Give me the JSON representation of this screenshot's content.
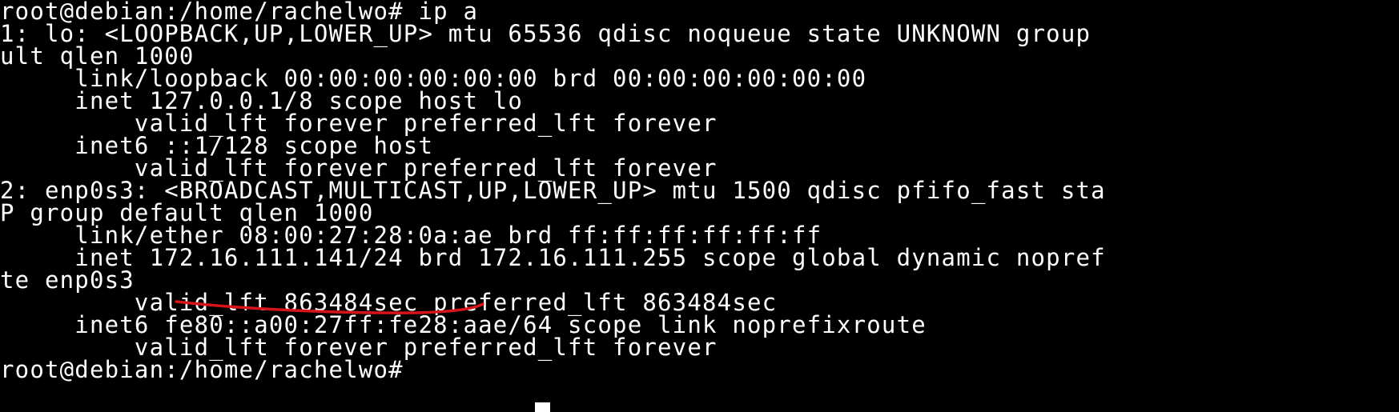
{
  "terminal": {
    "lines": [
      "root@debian:/home/rachelwo# ip a",
      "1: lo: <LOOPBACK,UP,LOWER_UP> mtu 65536 qdisc noqueue state UNKNOWN group",
      "ult qlen 1000",
      "     link/loopback 00:00:00:00:00:00 brd 00:00:00:00:00:00",
      "     inet 127.0.0.1/8 scope host lo",
      "         valid_lft forever preferred_lft forever",
      "     inet6 ::1/128 scope host",
      "         valid_lft forever preferred_lft forever",
      "2: enp0s3: <BROADCAST,MULTICAST,UP,LOWER_UP> mtu 1500 qdisc pfifo_fast sta",
      "P group default qlen 1000",
      "     link/ether 08:00:27:28:0a:ae brd ff:ff:ff:ff:ff:ff",
      "     inet 172.16.111.141/24 brd 172.16.111.255 scope global dynamic nopref",
      "te enp0s3",
      "         valid_lft 863484sec preferred_lft 863484sec",
      "     inet6 fe80::a00:27ff:fe28:aae/64 scope link noprefixroute",
      "         valid_lft forever preferred_lft forever",
      "root@debian:/home/rachelwo# "
    ],
    "annotation_color": "#d7141a"
  }
}
